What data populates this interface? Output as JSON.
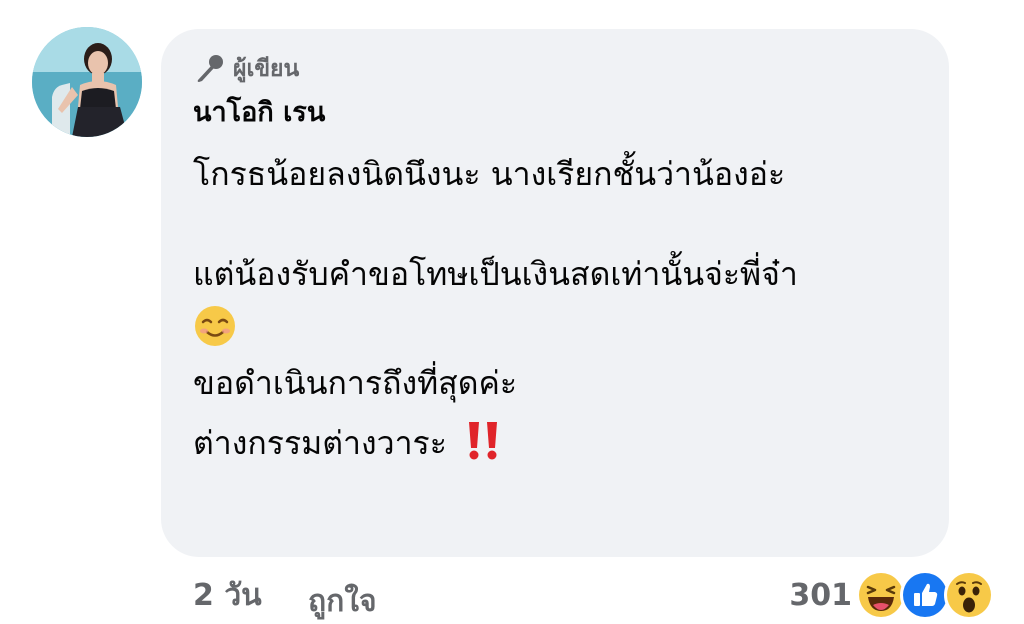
{
  "comment": {
    "author_badge": "ผู้เขียน",
    "author_name": "นาโอกิ เรน",
    "lines": [
      "โกรธน้อยลงนิดนึงนะ นางเรียกชั้นว่าน้องอ่ะ",
      "แต่น้องรับคำขอโทษเป็นเงินสดเท่านั้นจ่ะพี่จ๋า",
      "ขอดำเนินการถึงที่สุดค่ะ",
      "ต่างกรรมต่างวาระ "
    ],
    "emoji_after_line2": "relieved-smile-emoji",
    "emoji_after_line4": "double-exclamation-emoji"
  },
  "meta": {
    "time": "2 วัน",
    "like_label": "ถูกใจ"
  },
  "reactions": {
    "count": "301",
    "icons": [
      "haha-icon",
      "like-icon",
      "wow-icon"
    ]
  },
  "colors": {
    "bubble": "#f0f2f5",
    "secondary_text": "#65676b",
    "like_blue": "#1877f2",
    "emoji_yellow": "#f7c948",
    "exclaim_red": "#e0242a"
  }
}
